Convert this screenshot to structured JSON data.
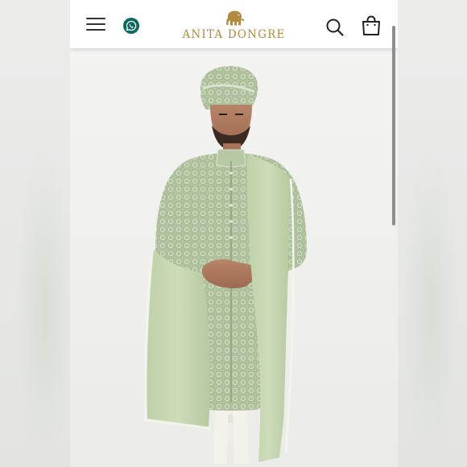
{
  "header": {
    "brand_name": "ANITA DONGRE",
    "brand_color": "#b18a3d",
    "icons": [
      "menu-icon",
      "whatsapp-icon",
      "search-icon",
      "shopping-bag-icon"
    ]
  },
  "hero": {
    "garment_color": "#b9cba6",
    "background_color": "#f1f1ef"
  }
}
